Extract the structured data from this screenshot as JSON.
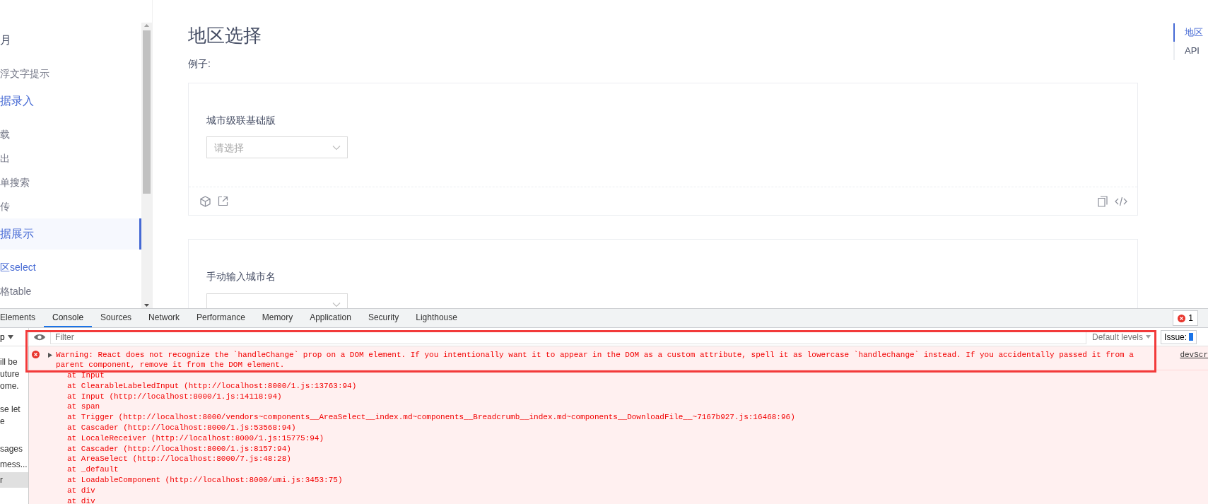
{
  "sidebar": {
    "items": [
      {
        "label": "月",
        "kind": "group",
        "active": false,
        "selected": false
      },
      {
        "label": "浮文字提示",
        "kind": "item",
        "active": false,
        "selected": false
      },
      {
        "label": "据录入",
        "kind": "group",
        "active": true,
        "selected": false
      },
      {
        "label": "载",
        "kind": "item",
        "active": false,
        "selected": false
      },
      {
        "label": "出",
        "kind": "item",
        "active": false,
        "selected": false
      },
      {
        "label": "单搜索",
        "kind": "item",
        "active": false,
        "selected": false
      },
      {
        "label": "传",
        "kind": "item",
        "active": false,
        "selected": false
      },
      {
        "label": "据展示",
        "kind": "group",
        "active": true,
        "selected": true
      },
      {
        "label": "区select",
        "kind": "item",
        "active": true,
        "selected": false
      },
      {
        "label": "格table",
        "kind": "item",
        "active": false,
        "selected": false
      }
    ]
  },
  "content": {
    "title": "地区选择",
    "intro": "例子:",
    "demos": [
      {
        "label": "城市级联基础版",
        "select": {
          "placeholder": "请选择"
        }
      },
      {
        "label": "手动输入城市名"
      }
    ]
  },
  "anchors": [
    {
      "label": "地区",
      "selected": true
    },
    {
      "label": "API",
      "selected": false
    }
  ],
  "devtools": {
    "tabs": [
      {
        "label": "Elements",
        "selected": false
      },
      {
        "label": "Console",
        "selected": true
      },
      {
        "label": "Sources",
        "selected": false
      },
      {
        "label": "Network",
        "selected": false
      },
      {
        "label": "Performance",
        "selected": false
      },
      {
        "label": "Memory",
        "selected": false
      },
      {
        "label": "Application",
        "selected": false
      },
      {
        "label": "Security",
        "selected": false
      },
      {
        "label": "Lighthouse",
        "selected": false
      }
    ],
    "error_count": "1",
    "context": "p",
    "filter": {
      "placeholder": "Filter"
    },
    "levels": "Default levels",
    "issues": "Issue:",
    "side_notes": [
      [
        "ill be",
        "uture",
        "ome."
      ],
      [
        "se let",
        "e"
      ]
    ],
    "side_items": [
      {
        "label": "sages",
        "selected": false
      },
      {
        "label": "mess...",
        "selected": false
      },
      {
        "label": "r",
        "selected": true
      }
    ],
    "message": {
      "text": "Warning: React does not recognize the `handleChange` prop on a DOM element. If you intentionally want it to appear in the DOM as a custom attribute, spell it as lowercase `handlechange` instead. If you accidentally passed it from a parent component, remove it from the DOM element.",
      "source": "devScr"
    },
    "stack": [
      {
        "text": "at Input"
      },
      {
        "text": "at ClearableLabeledInput (",
        "link": "http://localhost:8000/1.js:13763:94",
        "end": ")"
      },
      {
        "text": "at Input (",
        "link": "http://localhost:8000/1.js:14118:94",
        "end": ")"
      },
      {
        "text": "at span"
      },
      {
        "text": "at Trigger (",
        "link": "http://localhost:8000/vendors~components__AreaSelect__index.md~components__Breadcrumb__index.md~components__DownloadFile__~7167b927.js:16468:96",
        "end": ")"
      },
      {
        "text": "at Cascader (",
        "link": "http://localhost:8000/1.js:53568:94",
        "end": ")"
      },
      {
        "text": "at LocaleReceiver (",
        "link": "http://localhost:8000/1.js:15775:94",
        "end": ")"
      },
      {
        "text": "at Cascader (",
        "link": "http://localhost:8000/1.js:8157:94",
        "end": ")"
      },
      {
        "text": "at AreaSelect (",
        "link": "http://localhost:8000/7.js:48:28",
        "end": ")"
      },
      {
        "text": "at _default"
      },
      {
        "text": "at LoadableComponent (",
        "link": "http://localhost:8000/umi.js:3453:75",
        "end": ")"
      },
      {
        "text": "at div"
      },
      {
        "text": "at div"
      }
    ]
  }
}
